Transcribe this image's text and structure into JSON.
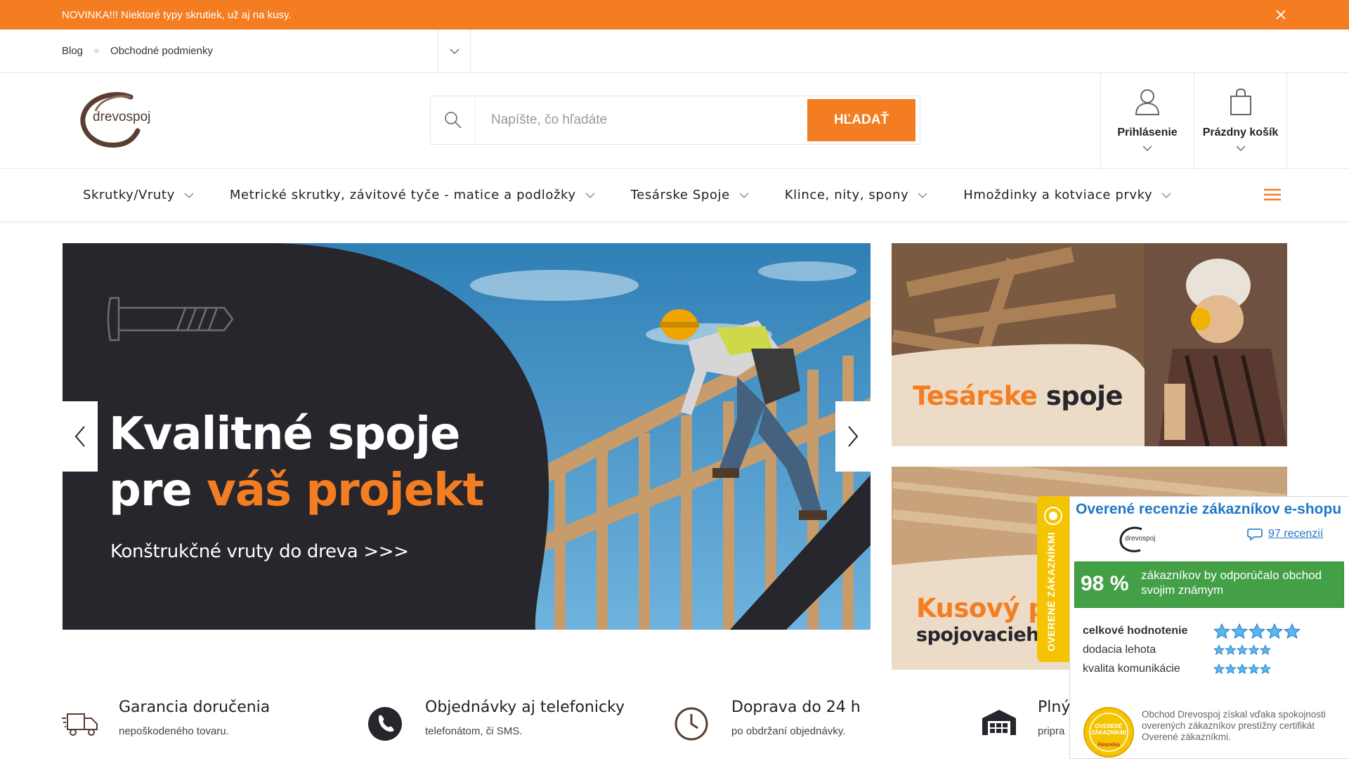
{
  "announcement": {
    "text": "NOVINKA!!! Niektoré typy skrutiek, už aj na kusy.",
    "close_icon": "close-icon"
  },
  "toplinks": {
    "items": [
      "Blog",
      "Obchodné podmienky"
    ]
  },
  "header": {
    "logo_text": "drevospoj",
    "search_placeholder": "Napíšte, čo hľadáte",
    "search_button": "HĽADAŤ",
    "login_label": "Prihlásenie",
    "cart_label": "Prázdny košík"
  },
  "nav": {
    "items": [
      "Skrutky/Vruty",
      "Metrické skrutky, závitové tyče - matice a podložky",
      "Tesárske Spoje",
      "Klince, nity, spony",
      "Hmoždinky a kotviace prvky"
    ]
  },
  "hero": {
    "line1": "Kvalitné spoje",
    "line2_a": "pre ",
    "line2_b": "váš projekt",
    "subtitle": "Konštrukčné vruty do dreva  >>>"
  },
  "banners": {
    "top_a": "Tesárske ",
    "top_b": "spoje",
    "bottom_a": "Kusový pr",
    "bottom_b": "spojovacieho"
  },
  "features": [
    {
      "title": "Garancia doručenia",
      "sub": "nepoškodeného tovaru.",
      "icon": "truck-icon"
    },
    {
      "title": "Objednávky aj telefonicky",
      "sub": "telefonátom, či SMS.",
      "icon": "phone-icon"
    },
    {
      "title": "Doprava do 24 h",
      "sub": "po obdržaní objednávky.",
      "icon": "clock-icon"
    },
    {
      "title": "Plný",
      "sub": "pripra",
      "icon": "warehouse-icon"
    }
  ],
  "reviews": {
    "tab_text": "OVERENÉ ZÁKAZNÍKMI",
    "title": "Overené recenzie zákazníkov e-shopu",
    "count": "97 recenzií",
    "logo_text": "drevospoj",
    "percent": "98 %",
    "percent_text": "zákazníkov by odporúčalo obchod svojim známym",
    "rows": [
      "celkové hodnotenie",
      "dodacia lehota",
      "kvalita komunikácie"
    ],
    "footer": "Obchod Drevospoj získal vďaka spokojnosti overených zákazníkov prestížny certifikát Overené zákazníkmi.",
    "badge_text": "OVERENÉ ZÁKAZNÍKMI",
    "badge_brand": "Heureka"
  },
  "colors": {
    "accent": "#f47d22",
    "dark": "#26262c",
    "review_blue": "#1f77c9",
    "review_green": "#43a047",
    "review_yellow": "#f5c400"
  }
}
